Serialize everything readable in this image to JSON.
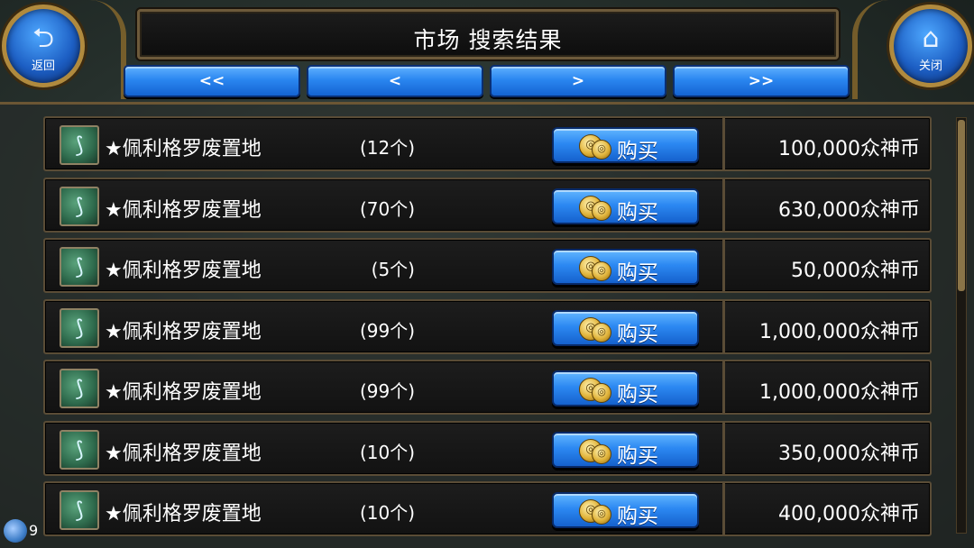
{
  "header": {
    "title": "市场 搜索结果",
    "back_label": "返回",
    "close_label": "关闭",
    "back_icon": "back-arrow-icon",
    "close_icon": "home-icon"
  },
  "pagination": {
    "first": "<<",
    "prev": "<",
    "next": ">",
    "last": ">>"
  },
  "list": {
    "buy_label": "购买",
    "items": [
      {
        "name": "★佩利格罗废置地",
        "qty": "(12个)",
        "price": "100,000众神币"
      },
      {
        "name": "★佩利格罗废置地",
        "qty": "(70个)",
        "price": "630,000众神币"
      },
      {
        "name": "★佩利格罗废置地",
        "qty": "(5个)",
        "price": "50,000众神币"
      },
      {
        "name": "★佩利格罗废置地",
        "qty": "(99个)",
        "price": "1,000,000众神币"
      },
      {
        "name": "★佩利格罗废置地",
        "qty": "(99个)",
        "price": "1,000,000众神币"
      },
      {
        "name": "★佩利格罗废置地",
        "qty": "(10个)",
        "price": "350,000众神币"
      },
      {
        "name": "★佩利格罗废置地",
        "qty": "(10个)",
        "price": "400,000众神币"
      }
    ]
  },
  "footer": {
    "badge_text": "9"
  },
  "colors": {
    "button_blue": "#2a86f0",
    "frame_gold": "#6b5634",
    "row_bg": "#151515"
  }
}
